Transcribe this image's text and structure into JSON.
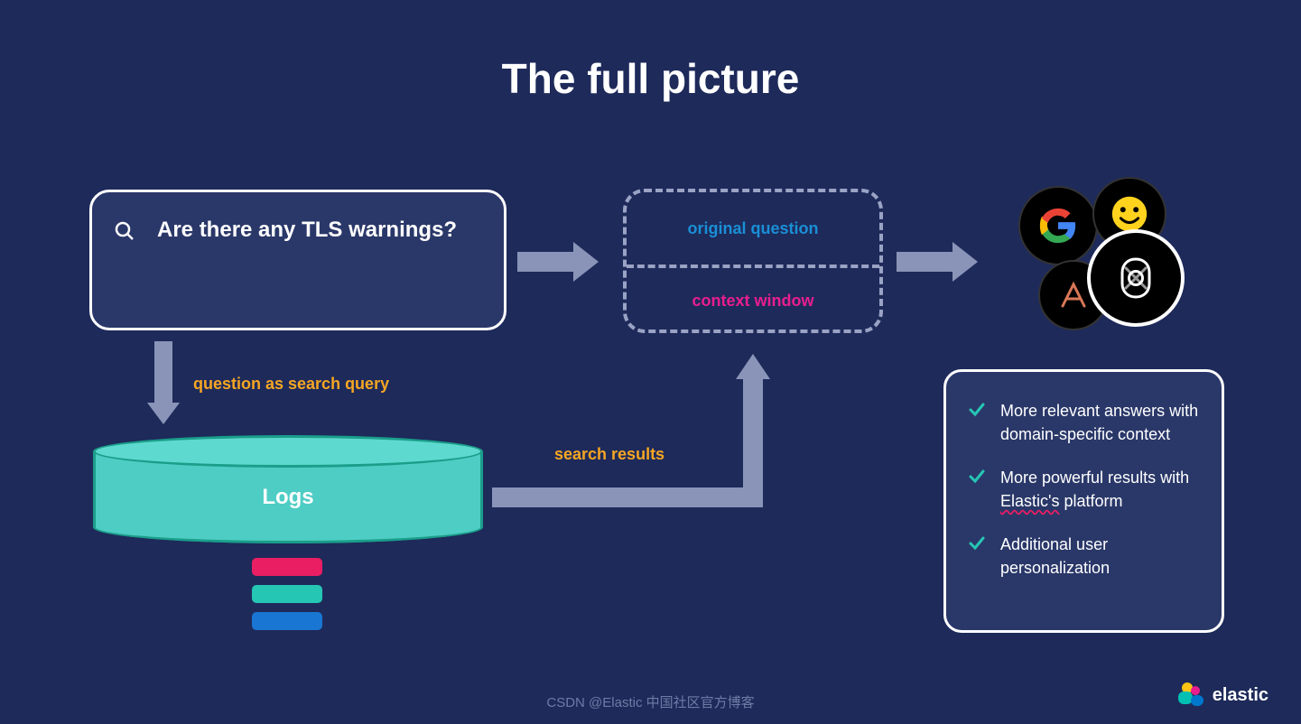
{
  "title": "The full picture",
  "search": {
    "question": "Are there any TLS warnings?"
  },
  "labels": {
    "query": "question as search query",
    "results": "search results",
    "original_question": "original question",
    "context_window": "context window"
  },
  "datastore": {
    "label": "Logs"
  },
  "llm_providers": [
    "google",
    "huggingface",
    "anthropic",
    "openai"
  ],
  "benefits": {
    "items": [
      "More relevant answers with domain-specific context",
      "More powerful results with Elastic's platform",
      "Additional user personalization"
    ]
  },
  "footer": {
    "attribution": "CSDN @Elastic 中国社区官方博客",
    "brand": "elastic"
  },
  "colors": {
    "background": "#1e2a5a",
    "arrow": "#8a94b8",
    "accent_orange": "#f5a623",
    "accent_teal": "#4ecdc4",
    "accent_pink": "#e91e63",
    "accent_blue": "#1976d2"
  }
}
